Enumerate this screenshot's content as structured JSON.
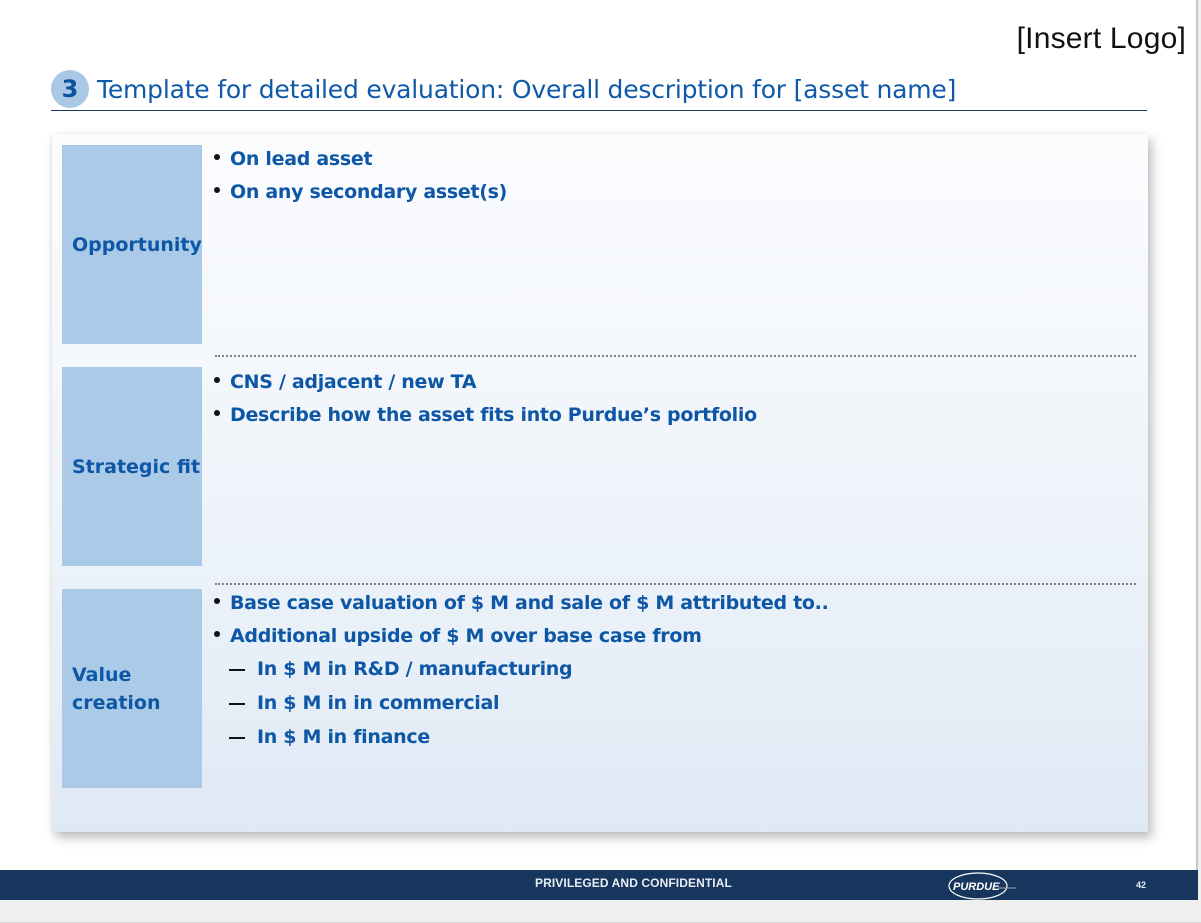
{
  "header": {
    "logo_placeholder": "[Insert Logo]",
    "step_number": "3",
    "title": "Template for detailed evaluation: Overall description for [asset name]"
  },
  "rows": [
    {
      "label": "Opportunity",
      "bullets": [
        "On lead asset",
        "On any secondary asset(s)"
      ]
    },
    {
      "label": "Strategic fit",
      "bullets": [
        "CNS / adjacent / new TA",
        "Describe how the asset fits into Purdue’s portfolio"
      ]
    },
    {
      "label": "Value creation",
      "bullets": [
        "Base case valuation of $ M and sale of $ M attributed to..",
        "Additional upside of $ M over base case from"
      ],
      "sub_bullets": [
        "In $  M in R&D / manufacturing",
        "In $  M in in commercial",
        "In $  M in finance"
      ]
    }
  ],
  "footer": {
    "confidentiality": "PRIVILEGED AND CONFIDENTIAL",
    "brand_logo": "PURDUE",
    "page_number": "42"
  },
  "colors": {
    "accent_blue": "#0d57a6",
    "label_fill": "#abcae7",
    "footer_bg": "#17365d"
  }
}
